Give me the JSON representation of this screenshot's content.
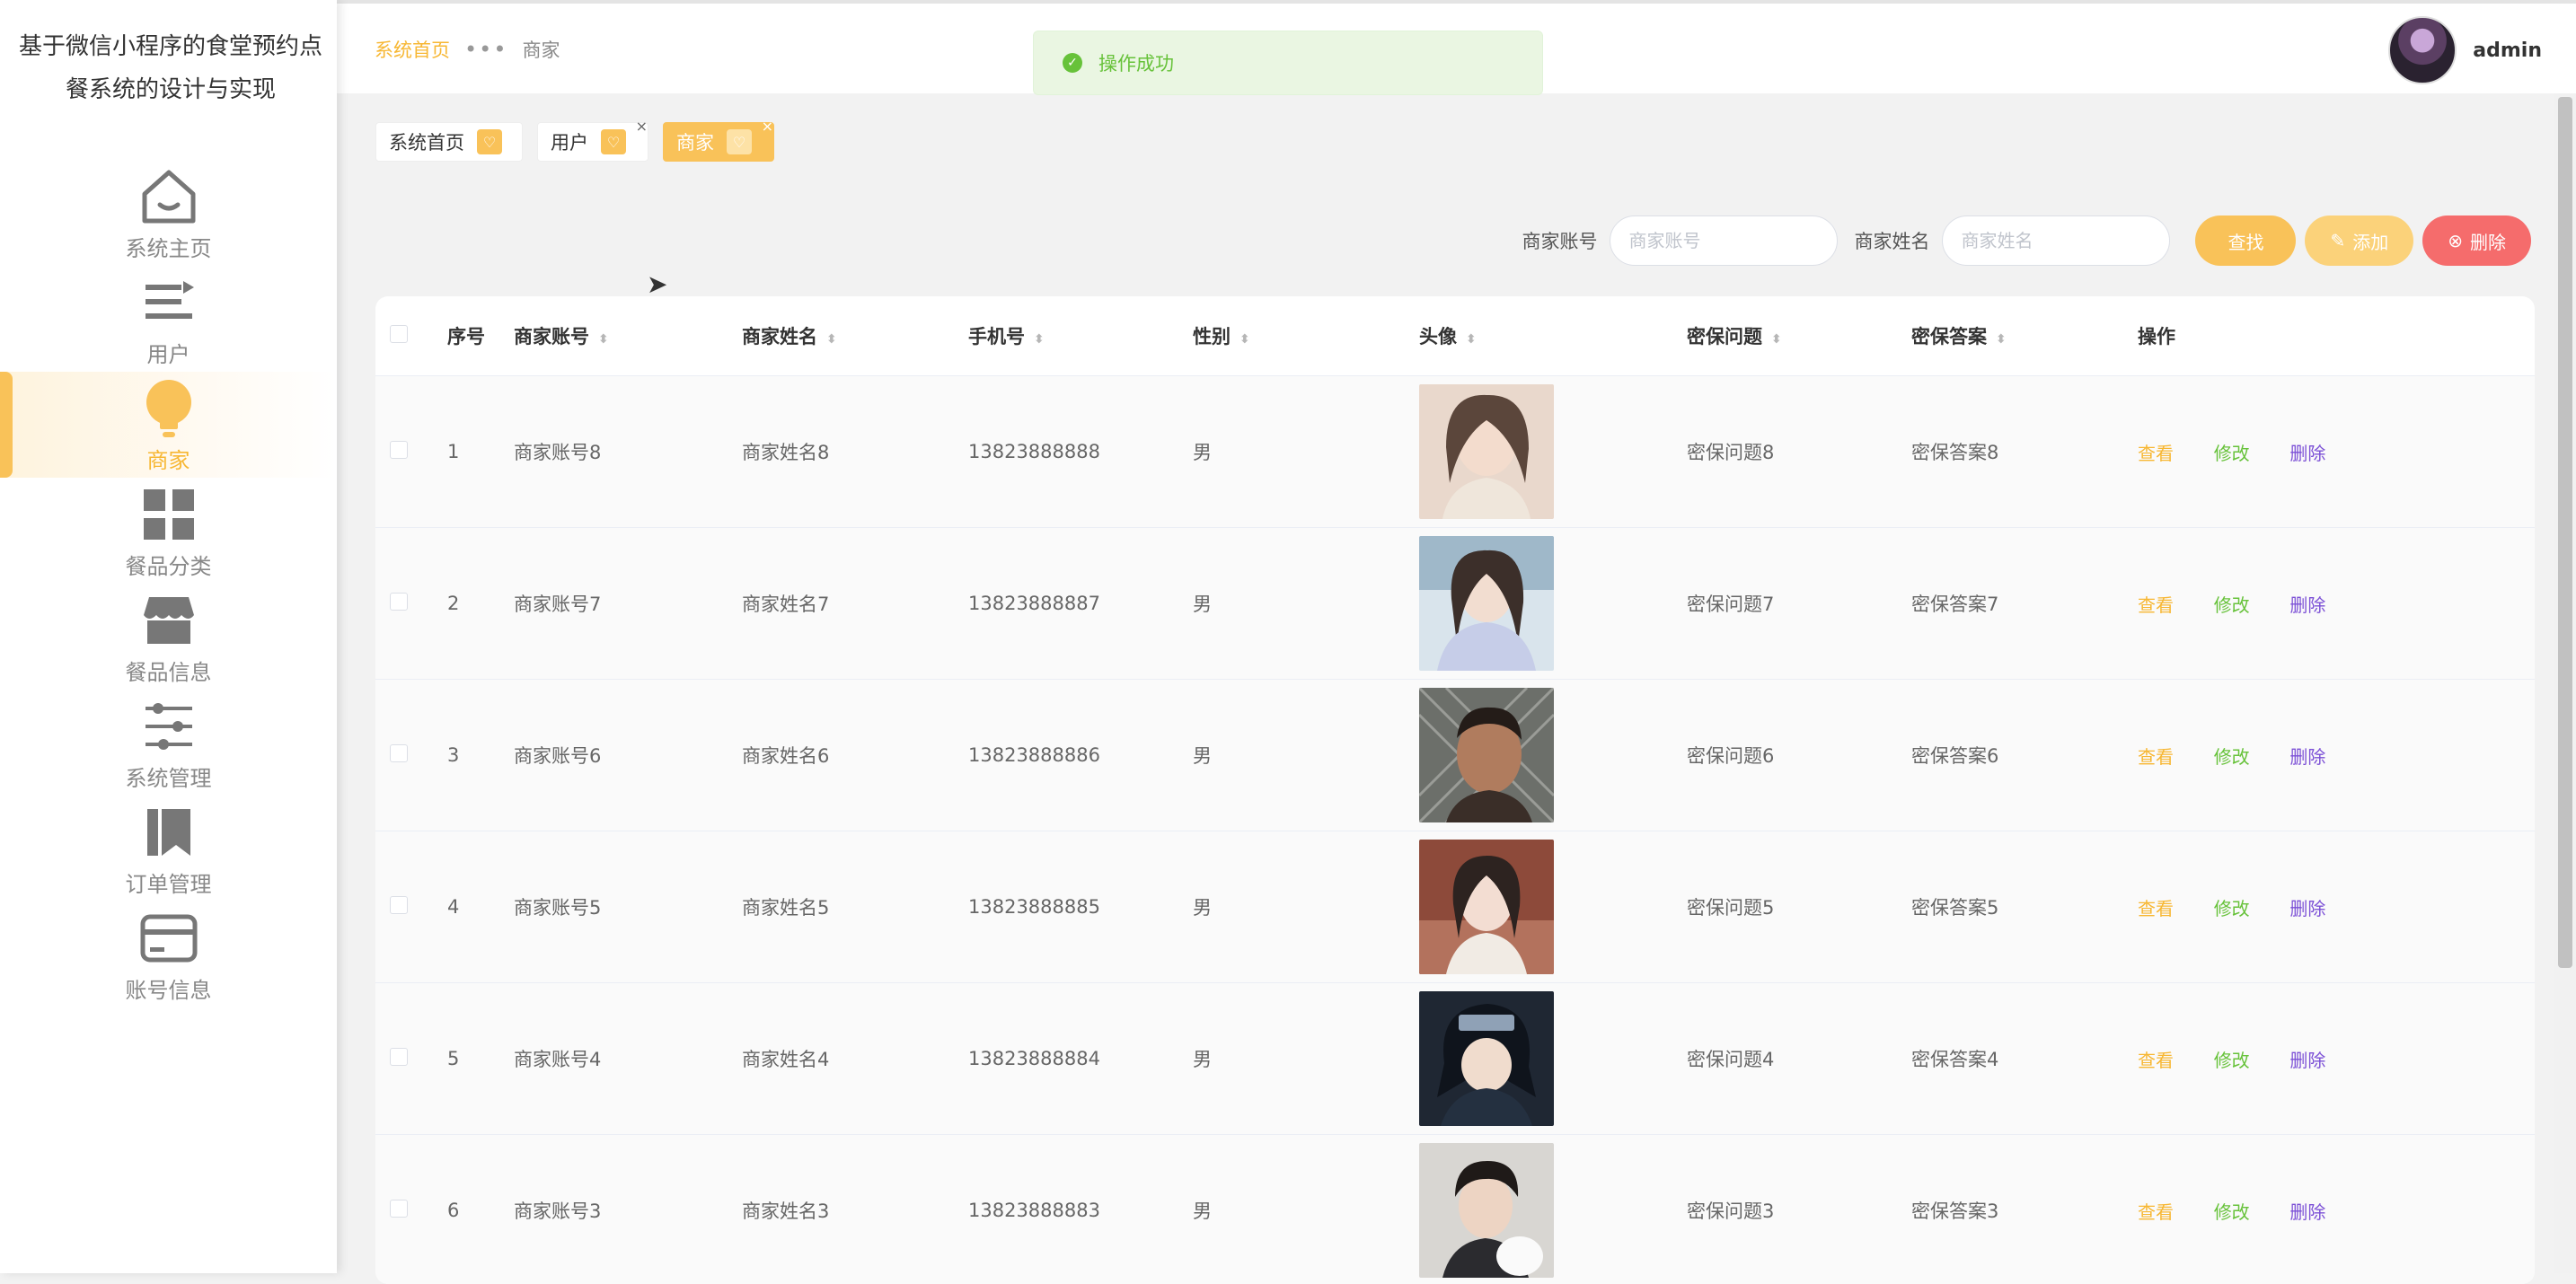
{
  "app": {
    "title": "基于微信小程序的食堂预约点餐系统的设计与实现"
  },
  "sidebar": {
    "items": [
      {
        "label": "系统主页",
        "icon": "home-icon"
      },
      {
        "label": "用户",
        "icon": "list-icon"
      },
      {
        "label": "商家",
        "icon": "bulb-icon",
        "active": true
      },
      {
        "label": "餐品分类",
        "icon": "grid-icon"
      },
      {
        "label": "餐品信息",
        "icon": "store-icon"
      },
      {
        "label": "系统管理",
        "icon": "sliders-icon"
      },
      {
        "label": "订单管理",
        "icon": "bookmark-icon"
      },
      {
        "label": "账号信息",
        "icon": "card-icon"
      }
    ]
  },
  "header": {
    "breadcrumb_home": "系统首页",
    "breadcrumb_current": "商家",
    "username": "admin"
  },
  "toast": {
    "message": "操作成功"
  },
  "tags": [
    {
      "label": "系统首页"
    },
    {
      "label": "用户"
    },
    {
      "label": "商家",
      "active": true
    }
  ],
  "search": {
    "account_label": "商家账号",
    "account_placeholder": "商家账号",
    "name_label": "商家姓名",
    "name_placeholder": "商家姓名",
    "find_button": "查找",
    "add_button": "添加",
    "delete_button": "删除"
  },
  "table": {
    "columns": {
      "index": "序号",
      "account": "商家账号",
      "name": "商家姓名",
      "phone": "手机号",
      "gender": "性别",
      "avatar": "头像",
      "question": "密保问题",
      "answer": "密保答案",
      "actions": "操作"
    },
    "actions": {
      "view": "查看",
      "edit": "修改",
      "delete": "删除"
    },
    "rows": [
      {
        "index": "1",
        "account": "商家账号8",
        "name": "商家姓名8",
        "phone": "13823888888",
        "gender": "男",
        "question": "密保问题8",
        "answer": "密保答案8"
      },
      {
        "index": "2",
        "account": "商家账号7",
        "name": "商家姓名7",
        "phone": "13823888887",
        "gender": "男",
        "question": "密保问题7",
        "answer": "密保答案7"
      },
      {
        "index": "3",
        "account": "商家账号6",
        "name": "商家姓名6",
        "phone": "13823888886",
        "gender": "男",
        "question": "密保问题6",
        "answer": "密保答案6"
      },
      {
        "index": "4",
        "account": "商家账号5",
        "name": "商家姓名5",
        "phone": "13823888885",
        "gender": "男",
        "question": "密保问题5",
        "answer": "密保答案5"
      },
      {
        "index": "5",
        "account": "商家账号4",
        "name": "商家姓名4",
        "phone": "13823888884",
        "gender": "男",
        "question": "密保问题4",
        "answer": "密保答案4"
      },
      {
        "index": "6",
        "account": "商家账号3",
        "name": "商家姓名3",
        "phone": "13823888883",
        "gender": "男",
        "question": "密保问题3",
        "answer": "密保答案3"
      }
    ]
  },
  "colors": {
    "accent": "#f9c259",
    "success": "#67c23a",
    "danger": "#f56c6c",
    "link_delete": "#7b4fd6"
  }
}
